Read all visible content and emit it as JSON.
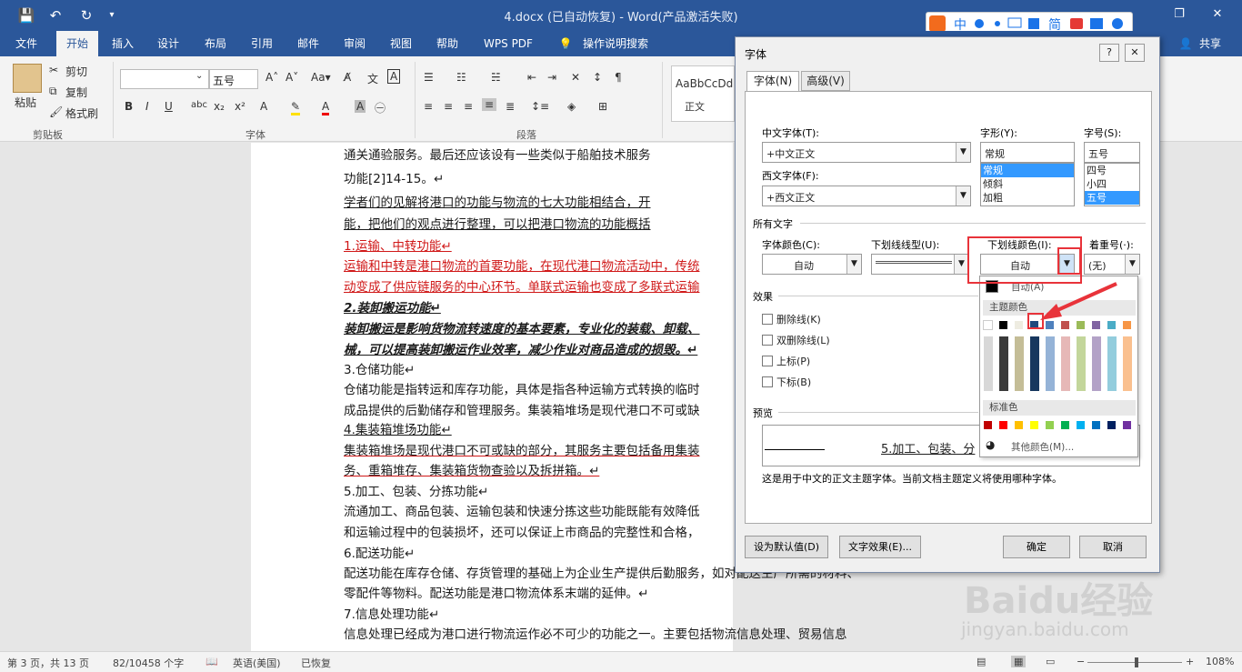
{
  "window": {
    "title": "4.docx (已自动恢复)  -  Word(产品激活失败)",
    "minimize": "—",
    "restore": "❐",
    "close": "✕"
  },
  "menu": {
    "items": [
      "文件",
      "开始",
      "插入",
      "设计",
      "布局",
      "引用",
      "邮件",
      "审阅",
      "视图",
      "帮助",
      "WPS PDF",
      "操作说明搜索"
    ],
    "share": "共享"
  },
  "ribbon": {
    "paste": "粘贴",
    "cut": "剪切",
    "copy": "复制",
    "format_painter": "格式刷",
    "clipboard_group": "剪贴板",
    "font_size": "五号",
    "font_group": "字体",
    "paragraph_group": "段落",
    "style_preview": "AaBbCcDd",
    "style_name": "正文"
  },
  "document": {
    "lines": [
      "通关通验服务。最后还应该设有一些类似于船舶技术服务",
      "功能[2]14-15。↵",
      "学者们的见解将港口的功能与物流的七大功能相结合，开",
      "能，把他们的观点进行整理，可以把港口物流的功能概括",
      "1.运输、中转功能↵",
      "运输和中转是港口物流的首要功能，在现代港口物流活动中，传统",
      "动变成了供应链服务的中心环节。单联式运输也变成了多联式运输",
      "2.装卸搬运功能↵",
      "装卸搬运是影响货物流转速度的基本要素，专业化的装载、卸载、",
      "械，可以提高装卸搬运作业效率，减少作业对商品造成的损毁。↵",
      "3.仓储功能↵",
      "仓储功能是指转运和库存功能，具体是指各种运输方式转换的临时",
      "成品提供的后勤储存和管理服务。集装箱堆场是现代港口不可或缺",
      "4.集装箱堆场功能↵",
      "集装箱堆场是现代港口不可或缺的部分，其服务主要包括备用集装",
      "务、重箱堆存、集装箱货物查验以及拆拼箱。↵",
      "5.加工、包装、分拣功能↵",
      "流通加工、商品包装、运输包装和快速分拣这些功能既能有效降低",
      "和运输过程中的包装损坏，还可以保证上市商品的完整性和合格，",
      "6.配送功能↵",
      "配送功能在库存仓储、存货管理的基础上为企业生产提供后勤服务，如对配送生产所需的材料、",
      "零配件等物料。配送功能是港口物流体系末端的延伸。↵",
      "7.信息处理功能↵",
      "信息处理已经成为港口进行物流运作必不可少的功能之一。主要包括物流信息处理、贸易信息"
    ]
  },
  "status": {
    "page": "第 3 页，共 13 页",
    "words": "82/10458 个字",
    "lang": "英语(美国)",
    "recovered": "已恢复",
    "zoom": "108%"
  },
  "dialog": {
    "title": "字体",
    "help": "?",
    "close": "✕",
    "tabs": [
      "字体(N)",
      "高级(V)"
    ],
    "cn_font_label": "中文字体(T):",
    "cn_font_value": "+中文正文",
    "west_font_label": "西文字体(F):",
    "west_font_value": "+西文正文",
    "style_label": "字形(Y):",
    "style_value": "常规",
    "style_options": [
      "常规",
      "倾斜",
      "加粗"
    ],
    "size_label": "字号(S):",
    "size_value": "五号",
    "size_options": [
      "四号",
      "小四",
      "五号"
    ],
    "all_text_label": "所有文字",
    "font_color_label": "字体颜色(C):",
    "font_color_value": "自动",
    "underline_label": "下划线线型(U):",
    "underline_color_label": "下划线颜色(I):",
    "underline_color_value": "自动",
    "emphasis_label": "着重号(·):",
    "emphasis_value": "(无)",
    "effects_label": "效果",
    "effects": [
      "删除线(K)",
      "双删除线(L)",
      "上标(P)",
      "下标(B)"
    ],
    "preview_label": "预览",
    "preview_text": "5.加工、包装、分",
    "preview_note": "这是用于中文的正文主题字体。当前文档主题定义将使用哪种字体。",
    "set_default": "设为默认值(D)",
    "text_effects": "文字效果(E)...",
    "ok": "确定",
    "cancel": "取消"
  },
  "palette": {
    "auto": "自动(A)",
    "theme_colors": "主题颜色",
    "standard_colors": "标准色",
    "more_colors": "其他颜色(M)...",
    "theme_row": [
      "#ffffff",
      "#000000",
      "#e7e6e6",
      "#44546a",
      "#4472c4",
      "#ed7d31",
      "#a5a5a5",
      "#ffc000",
      "#5b9bd5",
      "#70ad47"
    ],
    "theme_row_visible": [
      "#ffffff",
      "#000000",
      "#eeece1",
      "#1f497d",
      "#4f81bd",
      "#c0504d",
      "#9bbb59",
      "#8064a2",
      "#4bacc6",
      "#f79646"
    ],
    "standard_row": [
      "#c00000",
      "#ff0000",
      "#ffc000",
      "#ffff00",
      "#92d050",
      "#00b050",
      "#00b0f0",
      "#0070c0",
      "#002060",
      "#7030a0"
    ]
  },
  "watermark": {
    "brand": "Baidu经验",
    "url": "jingyan.baidu.com"
  }
}
